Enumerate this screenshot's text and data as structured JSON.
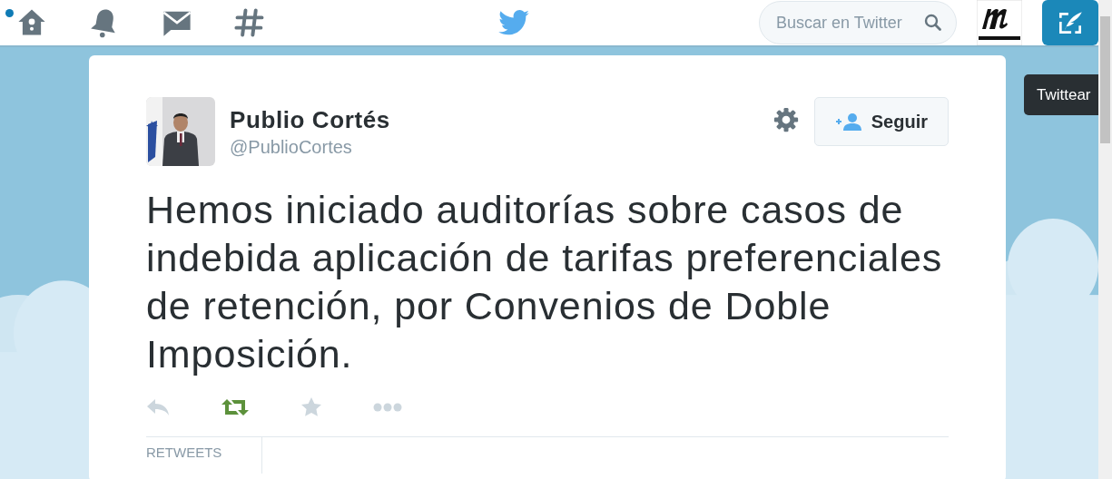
{
  "top_bar": {
    "nav": [
      {
        "kind": "home",
        "new_items": true
      },
      {
        "kind": "notifications",
        "new_items": false
      },
      {
        "kind": "messages",
        "new_items": false
      },
      {
        "kind": "discover",
        "new_items": false
      }
    ],
    "search": {
      "placeholder": "Buscar en Twitter"
    },
    "tooltip": "Twittear"
  },
  "tweet": {
    "author": {
      "name": "Publio Cortés",
      "handle": "@PublioCortes"
    },
    "follow_button": "Seguir",
    "text": "Hemos iniciado auditorías sobre casos de indebida aplicación de tarifas preferenciales de retención, por Convenios de Doble Imposición.",
    "actions": {
      "retweeted": true,
      "favorited": false
    },
    "stats_label": "RETWEETS"
  }
}
